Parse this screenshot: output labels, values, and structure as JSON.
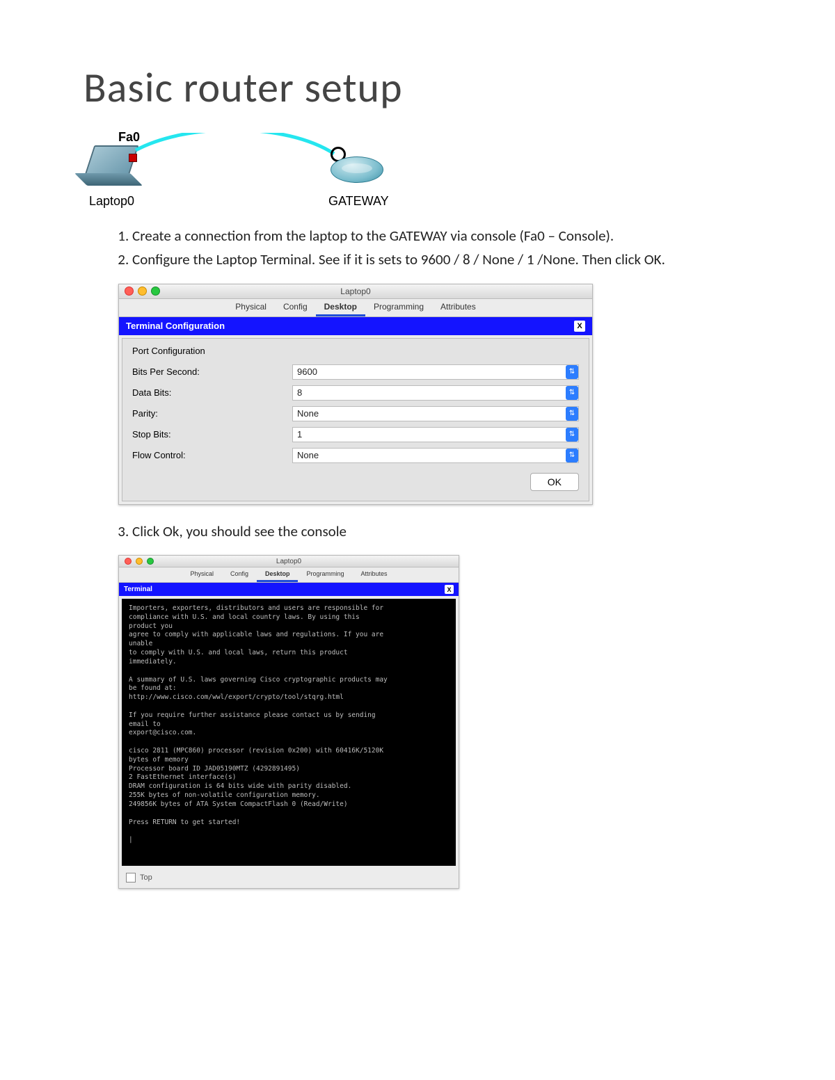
{
  "title": "Basic router setup",
  "diagram": {
    "port_label": "Fa0",
    "laptop_label": "Laptop0",
    "gateway_label": "GATEWAY"
  },
  "steps": {
    "s1": "Create a connection from the laptop to the GATEWAY via console (Fa0 – Console).",
    "s2": "Configure the Laptop Terminal. See if it is sets to 9600 / 8 / None / 1 /None. Then click OK.",
    "s3": "Click Ok, you should see the console"
  },
  "win1": {
    "title": "Laptop0",
    "tabs": [
      "Physical",
      "Config",
      "Desktop",
      "Programming",
      "Attributes"
    ],
    "active_tab": "Desktop",
    "header": "Terminal Configuration",
    "close": "X",
    "sub": "Port Configuration",
    "rows": [
      {
        "label": "Bits Per Second:",
        "value": "9600"
      },
      {
        "label": "Data Bits:",
        "value": "8"
      },
      {
        "label": "Parity:",
        "value": "None"
      },
      {
        "label": "Stop Bits:",
        "value": "1"
      },
      {
        "label": "Flow Control:",
        "value": "None"
      }
    ],
    "ok": "OK"
  },
  "win2": {
    "title": "Laptop0",
    "tabs": [
      "Physical",
      "Config",
      "Desktop",
      "Programming",
      "Attributes"
    ],
    "active_tab": "Desktop",
    "header": "Terminal",
    "close": "X",
    "console": "Importers, exporters, distributors and users are responsible for\ncompliance with U.S. and local country laws. By using this\nproduct you\nagree to comply with applicable laws and regulations. If you are\nunable\nto comply with U.S. and local laws, return this product\nimmediately.\n\nA summary of U.S. laws governing Cisco cryptographic products may\nbe found at:\nhttp://www.cisco.com/wwl/export/crypto/tool/stqrg.html\n\nIf you require further assistance please contact us by sending\nemail to\nexport@cisco.com.\n\ncisco 2811 (MPC860) processor (revision 0x200) with 60416K/5120K\nbytes of memory\nProcessor board ID JAD05190MTZ (4292891495)\n2 FastEthernet interface(s)\nDRAM configuration is 64 bits wide with parity disabled.\n255K bytes of non-volatile configuration memory.\n249856K bytes of ATA System CompactFlash 0 (Read/Write)\n\nPress RETURN to get started!\n\n|",
    "top": "Top"
  }
}
